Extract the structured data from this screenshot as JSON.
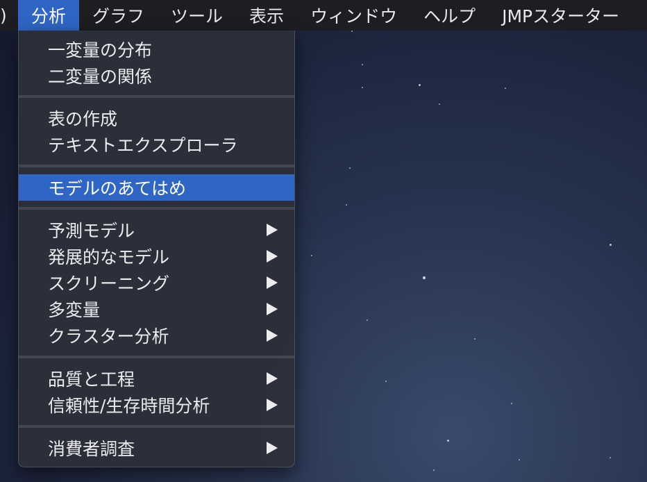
{
  "menubar": {
    "items": [
      {
        "label": ")"
      },
      {
        "label": "分析"
      },
      {
        "label": "グラフ"
      },
      {
        "label": "ツール"
      },
      {
        "label": "表示"
      },
      {
        "label": "ウィンドウ"
      },
      {
        "label": "ヘルプ"
      },
      {
        "label": "JMPスターター"
      }
    ]
  },
  "menu": {
    "group1": [
      {
        "label": "一変量の分布"
      },
      {
        "label": "二変量の関係"
      }
    ],
    "group2": [
      {
        "label": "表の作成"
      },
      {
        "label": "テキストエクスプローラ"
      }
    ],
    "group3": [
      {
        "label": "モデルのあてはめ"
      }
    ],
    "group4": [
      {
        "label": "予測モデル"
      },
      {
        "label": "発展的なモデル"
      },
      {
        "label": "スクリーニング"
      },
      {
        "label": "多変量"
      },
      {
        "label": "クラスター分析"
      }
    ],
    "group5": [
      {
        "label": "品質と工程"
      },
      {
        "label": "信頼性/生存時間分析"
      }
    ],
    "group6": [
      {
        "label": "消費者調査"
      }
    ]
  },
  "icons": {
    "submenu_arrow": "submenu-arrow-icon"
  },
  "colors": {
    "highlight": "#2f66c6",
    "menubar_bg": "#1d1e22",
    "menu_bg": "#2c303a"
  }
}
